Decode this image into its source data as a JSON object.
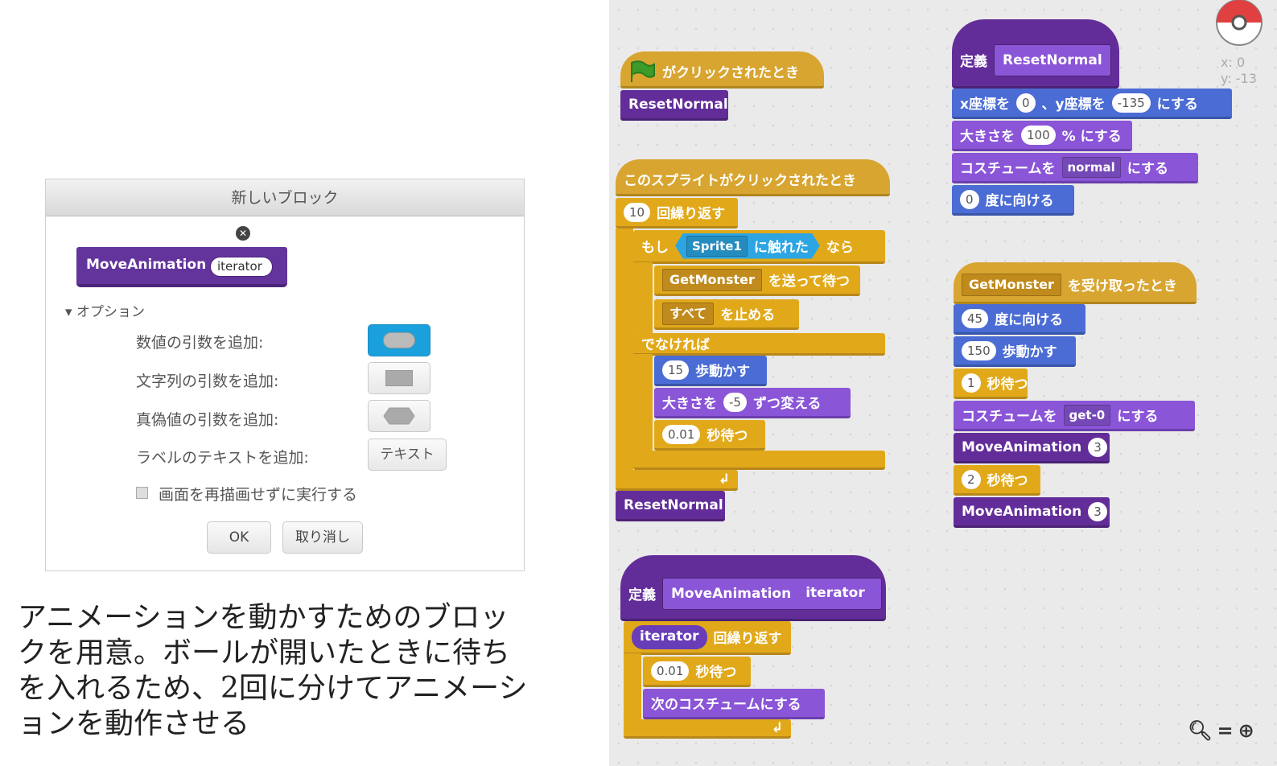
{
  "dialog": {
    "title": "新しいブロック",
    "block_name": "MoveAnimation",
    "block_arg": "iterator",
    "options_label": "オプション",
    "add_number": "数値の引数を追加:",
    "add_string": "文字列の引数を追加:",
    "add_boolean": "真偽値の引数を追加:",
    "add_label": "ラベルのテキストを追加:",
    "text_button": "テキスト",
    "run_without_refresh": "画面を再描画せずに実行する",
    "ok": "OK",
    "cancel": "取り消し"
  },
  "caption": "アニメーションを動かすためのブロックを用意。ボールが開いたときに待ちを入れるため、2回に分けてアニメーションを動作させる",
  "scripts": {
    "flag_hat": "がクリックされたとき",
    "reset_normal": "ResetNormal",
    "sprite_clicked": "このスプライトがクリックされたとき",
    "repeat10_n": "10",
    "repeat_label": "回繰り返す",
    "if_label": "もし",
    "sprite1": "Sprite1",
    "touching": "に触れた",
    "then": "なら",
    "getmonster": "GetMonster",
    "broadcast_wait": "を送って待つ",
    "all": "すべて",
    "stop": "を止める",
    "else": "でなければ",
    "move_n": "15",
    "move_label": "歩動かす",
    "size_by": "大きさを",
    "size_by_n": "-5",
    "size_by_label": "ずつ変える",
    "wait_001": "0.01",
    "wait_label": "秒待つ",
    "define": "定義",
    "move_animation": "MoveAnimation",
    "iterator": "iterator",
    "next_costume": "次のコスチュームにする",
    "x_label": "x座標を",
    "x_val": "0",
    "y_label": "、y座標を",
    "y_val": "-135",
    "set_label": "にする",
    "size_label": "大きさを",
    "size_val": "100",
    "size_pct": "% にする",
    "costume_label": "コスチュームを",
    "costume_normal": "normal",
    "point_val": "0",
    "point_label": "度に向ける",
    "receive_label": "を受け取ったとき",
    "point45": "45",
    "move150": "150",
    "wait1": "1",
    "wait_label2": "秒待つ",
    "costume_get": "get-0",
    "arg3": "3",
    "wait2": "2"
  },
  "stage": {
    "x": "x: 0",
    "y": "y: -13"
  },
  "zoom": {
    "out": "−",
    "reset": "=",
    "in": "+"
  }
}
